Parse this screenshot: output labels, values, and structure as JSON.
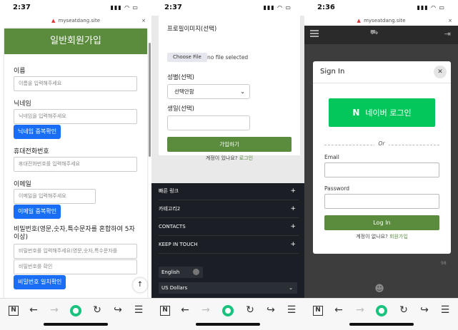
{
  "colors": {
    "green": "#5b8c3e",
    "blue": "#1a6ef5",
    "naver": "#03c75a",
    "footer": "#1b1f25"
  },
  "p1": {
    "time": "2:37",
    "url": "myseatdang.site",
    "title": "일반회원가입",
    "name_label": "이름",
    "name_ph": "이름을 입력해주세요",
    "nick_label": "닉네임",
    "nick_ph": "닉네임을 입력해주세요",
    "nick_btn": "닉네임 중복확인",
    "phone_label": "휴대전화번호",
    "phone_ph": "휴대전화번호를 입력해주세요",
    "email_label": "이메일",
    "email_ph": "이메일을 입력해주세요",
    "email_btn": "이메일 중복확인",
    "pw_label": "비밀번호(영문,숫자,특수문자를 혼합하여 5자 이상)",
    "pw_ph": "비밀번호를 입력해주세요(영문,숫자,특수문자를",
    "pw2_ph": "비밀번호를 확인",
    "pw_btn": "비밀번호 일치확인"
  },
  "p2": {
    "time": "2:37",
    "profile_label": "프로필이미지(선택)",
    "choose": "Choose File",
    "nofile": "no file selected",
    "gender_label": "성별(선택)",
    "gender_value": "선택안함",
    "birth_label": "생일(선택)",
    "join_btn": "가입하기",
    "login_q": "계정이 있나요?",
    "login_link": "로그인",
    "footer": [
      "빠른 링크",
      "카테고리2",
      "CONTACTS",
      "KEEP IN TOUCH"
    ],
    "language": "English",
    "currency": "US Dollars"
  },
  "p3": {
    "time": "2:36",
    "url": "myseatdang.site",
    "modal_title": "Sign In",
    "naver_btn": "네이버 로그인",
    "naver_logo": "N",
    "or": "Or",
    "email_label": "Email",
    "password_label": "Password",
    "login_btn": "Log In",
    "signup_q": "계정이 없나요?",
    "signup_link": "회원가입",
    "badge": "98"
  },
  "toolbar": {
    "n": "N",
    "back": "←",
    "fwd": "→",
    "refresh": "↻",
    "share": "↪",
    "menu": "☰"
  }
}
